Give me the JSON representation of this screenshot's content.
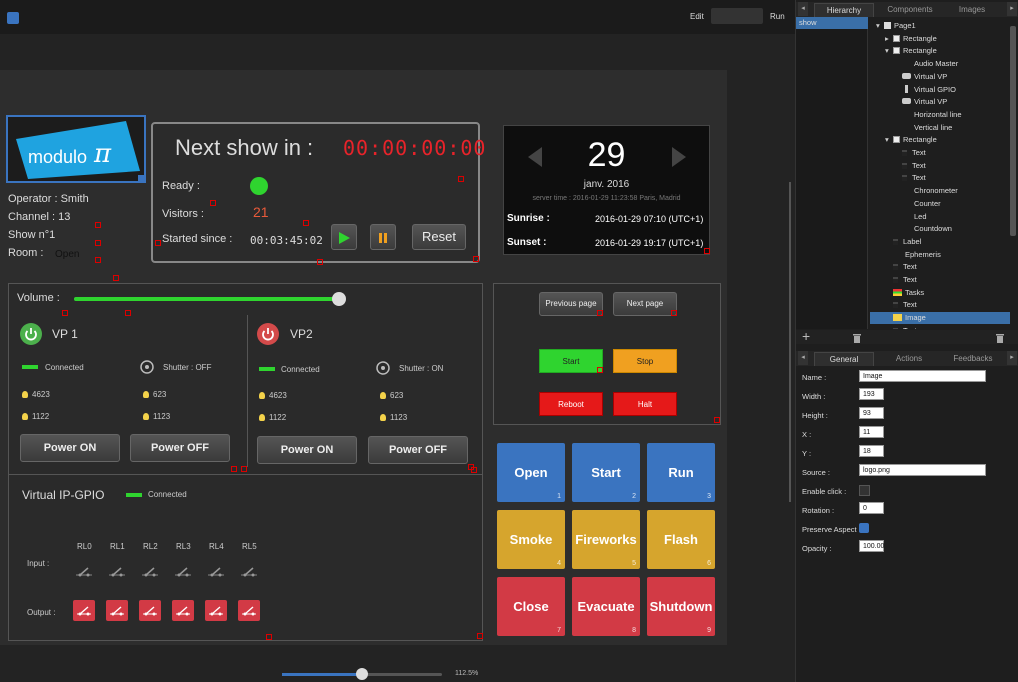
{
  "topbar": {
    "edit_label": "Edit",
    "run_label": "Run"
  },
  "logo": {
    "text": "modulo",
    "pi": "π"
  },
  "info": {
    "operator": "Operator : Smith",
    "channel": "Channel : 13",
    "show": "Show n°1",
    "room_label": "Room :",
    "room_value": "Open"
  },
  "next_show": {
    "title": "Next show in :",
    "countdown": "00:00:00:00",
    "ready_label": "Ready :",
    "visitors_label": "Visitors :",
    "visitors_value": "21",
    "started_label": "Started since :",
    "started_value": "00:03:45:02",
    "reset_label": "Reset"
  },
  "date_panel": {
    "day": "29",
    "month": "janv. 2016",
    "server_time": "server time : 2016-01-29 11:23:58 Paris, Madrid",
    "sunrise_label": "Sunrise :",
    "sunrise_value": "2016-01-29 07:10 (UTC+1)",
    "sunset_label": "Sunset :",
    "sunset_value": "2016-01-29 19:17 (UTC+1)"
  },
  "volume": {
    "label": "Volume :",
    "level": 0.98
  },
  "vp1": {
    "name": "VP 1",
    "status": "Connected",
    "shutter": "Shutter : OFF",
    "lamp1": "4623",
    "lamp2": "1122",
    "lamp3": "623",
    "lamp4": "1123",
    "power_on": "Power ON",
    "power_off": "Power OFF"
  },
  "vp2": {
    "name": "VP2",
    "status": "Connected",
    "shutter": "Shutter : ON",
    "lamp1": "4623",
    "lamp2": "1122",
    "lamp3": "623",
    "lamp4": "1123",
    "power_on": "Power ON",
    "power_off": "Power OFF"
  },
  "gpio": {
    "title": "Virtual IP-GPIO",
    "status": "Connected",
    "input_label": "Input :",
    "output_label": "Output :",
    "relays": [
      "RL0",
      "RL1",
      "RL2",
      "RL3",
      "RL4",
      "RL5"
    ]
  },
  "control": {
    "prev_page": "Previous page",
    "next_page": "Next page",
    "start": "Start",
    "stop": "Stop",
    "reboot": "Reboot",
    "halt": "Halt"
  },
  "tiles": [
    {
      "label": "Open",
      "num": "1",
      "color": "#3a74c0"
    },
    {
      "label": "Start",
      "num": "2",
      "color": "#3a74c0"
    },
    {
      "label": "Run",
      "num": "3",
      "color": "#3a74c0"
    },
    {
      "label": "Smoke",
      "num": "4",
      "color": "#d6a52d"
    },
    {
      "label": "Fireworks",
      "num": "5",
      "color": "#d6a52d"
    },
    {
      "label": "Flash",
      "num": "6",
      "color": "#d6a52d"
    },
    {
      "label": "Close",
      "num": "7",
      "color": "#d23a45"
    },
    {
      "label": "Evacuate",
      "num": "8",
      "color": "#d23a45"
    },
    {
      "label": "Shutdown",
      "num": "9",
      "color": "#d23a45"
    }
  ],
  "zoom": {
    "label": "112.5%",
    "level": 0.5
  },
  "panel_tabs": {
    "hierarchy": "Hierarchy",
    "components": "Components",
    "images": "Images"
  },
  "page_list": [
    "show"
  ],
  "tree": [
    {
      "label": "Page1",
      "depth": 0,
      "arrow": "▾",
      "icon": "page"
    },
    {
      "label": "Rectangle",
      "depth": 1,
      "arrow": "▸",
      "icon": "rect"
    },
    {
      "label": "Rectangle",
      "depth": 1,
      "arrow": "▾",
      "icon": "rect"
    },
    {
      "label": "Audio Master",
      "depth": 2,
      "arrow": "",
      "icon": ""
    },
    {
      "label": "Virtual VP",
      "depth": 2,
      "arrow": "",
      "icon": "vp"
    },
    {
      "label": "Virtual GPIO",
      "depth": 2,
      "arrow": "",
      "icon": "gpio"
    },
    {
      "label": "Virtual VP",
      "depth": 2,
      "arrow": "",
      "icon": "vp"
    },
    {
      "label": "Horizontal line",
      "depth": 2,
      "arrow": "",
      "icon": ""
    },
    {
      "label": "Vertical line",
      "depth": 2,
      "arrow": "",
      "icon": ""
    },
    {
      "label": "Rectangle",
      "depth": 1,
      "arrow": "▾",
      "icon": "rect"
    },
    {
      "label": "Text",
      "depth": 2,
      "arrow": "",
      "icon": "text"
    },
    {
      "label": "Text",
      "depth": 2,
      "arrow": "",
      "icon": "text"
    },
    {
      "label": "Text",
      "depth": 2,
      "arrow": "",
      "icon": "text"
    },
    {
      "label": "Chronometer",
      "depth": 2,
      "arrow": "",
      "icon": ""
    },
    {
      "label": "Counter",
      "depth": 2,
      "arrow": "",
      "icon": ""
    },
    {
      "label": "Led",
      "depth": 2,
      "arrow": "",
      "icon": ""
    },
    {
      "label": "Countdown",
      "depth": 2,
      "arrow": "",
      "icon": ""
    },
    {
      "label": "Label",
      "depth": 1,
      "arrow": "",
      "icon": "text"
    },
    {
      "label": "Ephemeris",
      "depth": 1,
      "arrow": "",
      "icon": ""
    },
    {
      "label": "Text",
      "depth": 1,
      "arrow": "",
      "icon": "text"
    },
    {
      "label": "Text",
      "depth": 1,
      "arrow": "",
      "icon": "text"
    },
    {
      "label": "Tasks",
      "depth": 1,
      "arrow": "",
      "icon": "tasks"
    },
    {
      "label": "Text",
      "depth": 1,
      "arrow": "",
      "icon": "text"
    },
    {
      "label": "Image",
      "depth": 1,
      "arrow": "",
      "icon": "image",
      "selected": true
    },
    {
      "label": "Text",
      "depth": 1,
      "arrow": "",
      "icon": "text"
    }
  ],
  "prop_tabs": {
    "general": "General",
    "actions": "Actions",
    "feedbacks": "Feedbacks"
  },
  "props": {
    "name_label": "Name :",
    "name_value": "Image",
    "width_label": "Width :",
    "width_value": "193",
    "height_label": "Height :",
    "height_value": "93",
    "x_label": "X :",
    "x_value": "11",
    "y_label": "Y :",
    "y_value": "18",
    "source_label": "Source :",
    "source_value": "logo.png",
    "enable_click_label": "Enable click :",
    "rotation_label": "Rotation :",
    "rotation_value": "0",
    "preserve_label": "Preserve Aspect :",
    "opacity_label": "Opacity :",
    "opacity_value": "100.00"
  },
  "colors": {
    "accent": "#3a74c0",
    "led_green": "#2fd42f",
    "countdown_red": "#e8232a"
  }
}
